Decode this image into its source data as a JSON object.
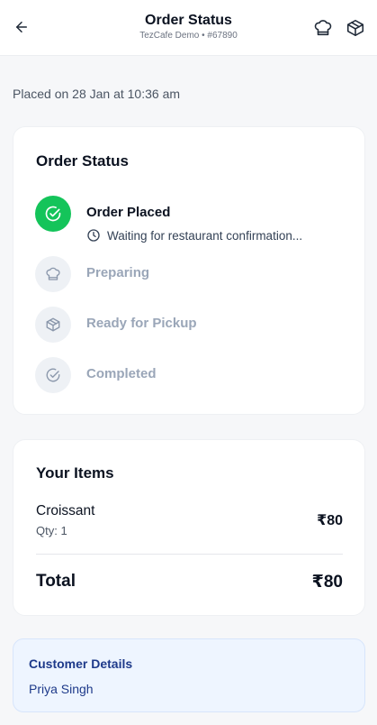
{
  "header": {
    "title": "Order Status",
    "subtitle": "TezCafe Demo • #67890",
    "back_icon": "arrow-left-icon",
    "actions": [
      "chef-hat-icon",
      "package-icon"
    ]
  },
  "placed_text": "Placed on 28 Jan at 10:36 am",
  "status_card": {
    "title": "Order Status",
    "steps": [
      {
        "label": "Order Placed",
        "state": "active",
        "icon": "check-circle-icon",
        "note": "Waiting for restaurant confirmation..."
      },
      {
        "label": "Preparing",
        "state": "pending",
        "icon": "chef-hat-icon"
      },
      {
        "label": "Ready for Pickup",
        "state": "pending",
        "icon": "package-icon"
      },
      {
        "label": "Completed",
        "state": "pending",
        "icon": "check-circle-icon"
      }
    ]
  },
  "items_card": {
    "title": "Your Items",
    "items": [
      {
        "name": "Croissant",
        "qty": "Qty: 1",
        "price": "₹80"
      }
    ],
    "total_label": "Total",
    "total_value": "₹80"
  },
  "customer": {
    "title": "Customer Details",
    "name": "Priya Singh"
  },
  "colors": {
    "accent_green": "#14c45a",
    "pending_gray": "#9aa6b8",
    "customer_blue": "#1e3a8a"
  }
}
